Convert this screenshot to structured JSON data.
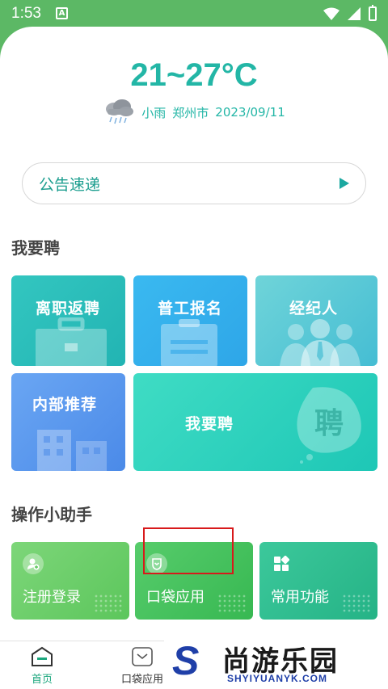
{
  "status_bar": {
    "time": "1:53",
    "notification": "A"
  },
  "weather": {
    "temperature": "21~27°C",
    "condition": "小雨",
    "city": "郑州市",
    "date": "2023/09/11"
  },
  "notice": {
    "label": "公告速递"
  },
  "hiring": {
    "title": "我要聘",
    "tiles": [
      {
        "label": "离职返聘"
      },
      {
        "label": "普工报名"
      },
      {
        "label": "经纪人"
      },
      {
        "label": "内部推荐"
      },
      {
        "label": "我要聘",
        "mark": "聘"
      }
    ]
  },
  "assistant": {
    "title": "操作小助手",
    "items": [
      {
        "label": "注册登录"
      },
      {
        "label": "口袋应用"
      },
      {
        "label": "常用功能"
      }
    ]
  },
  "bottom_nav": {
    "items": [
      {
        "label": "首页"
      },
      {
        "label": "口袋应用"
      }
    ]
  },
  "watermark": {
    "letter": "S",
    "cn": "尚游乐园",
    "en": "SHYIYUANYK.COM"
  },
  "colors": {
    "accent": "#23b6a6",
    "status_bar": "#5cb865",
    "highlight": "#d8191b"
  }
}
